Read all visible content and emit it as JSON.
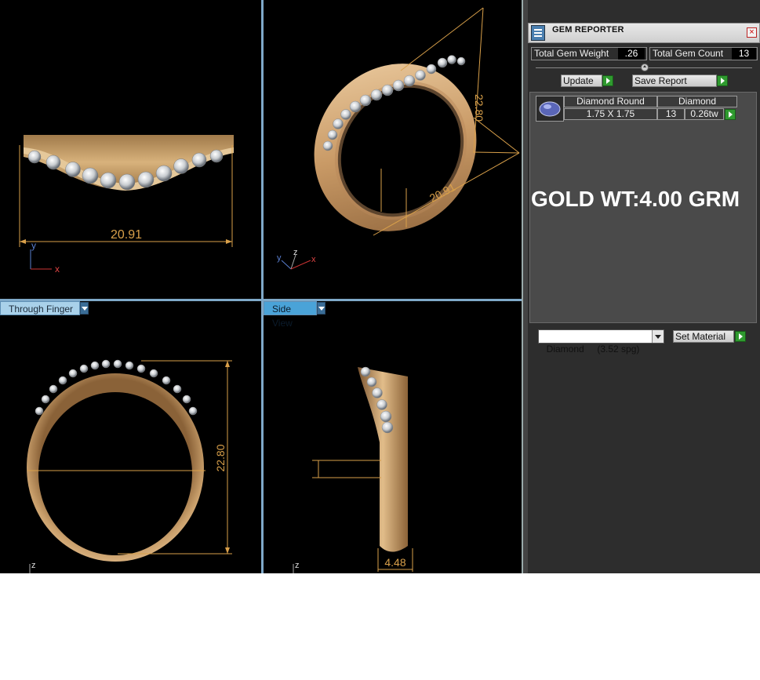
{
  "viewports": {
    "top_left": {
      "dimension": "20.91",
      "axes": [
        "y",
        "x"
      ]
    },
    "top_right": {
      "dimensions": [
        "22.80",
        "20.91"
      ],
      "axes": [
        "y",
        "z",
        "x"
      ]
    },
    "bottom_left": {
      "label": "Through Finger",
      "dimension": "22.80",
      "axes": [
        "z"
      ]
    },
    "bottom_right": {
      "label": "Side View",
      "dimension": "4.48",
      "axes": [
        "z"
      ]
    }
  },
  "panel": {
    "title": "GEM REPORTER",
    "close_symbol": "×",
    "total_gem_weight_label": "Total Gem Weight",
    "total_gem_weight_value": ".26",
    "total_gem_count_label": "Total Gem Count",
    "total_gem_count_value": "13",
    "update_label": "Update",
    "save_report_label": "Save Report",
    "gem_row": {
      "shape": "Diamond Round",
      "material": "Diamond",
      "size": "1.75 X 1.75",
      "count": "13",
      "carat": "0.26tw"
    },
    "gold_weight": "GOLD WT:4.00 GRM",
    "material_select": "Diamond     (3.52 spg)",
    "set_material_label": "Set Material"
  },
  "colors": {
    "dimension": "#d9a04a",
    "gold": "#c89a63",
    "viewport_bg": "#000000",
    "panel_bg": "#2d2d2d"
  },
  "icons": [
    "gem-reporter-icon",
    "close-icon",
    "green-arrow-icon",
    "dropdown-arrow-icon",
    "diamond-thumbnail-icon"
  ]
}
